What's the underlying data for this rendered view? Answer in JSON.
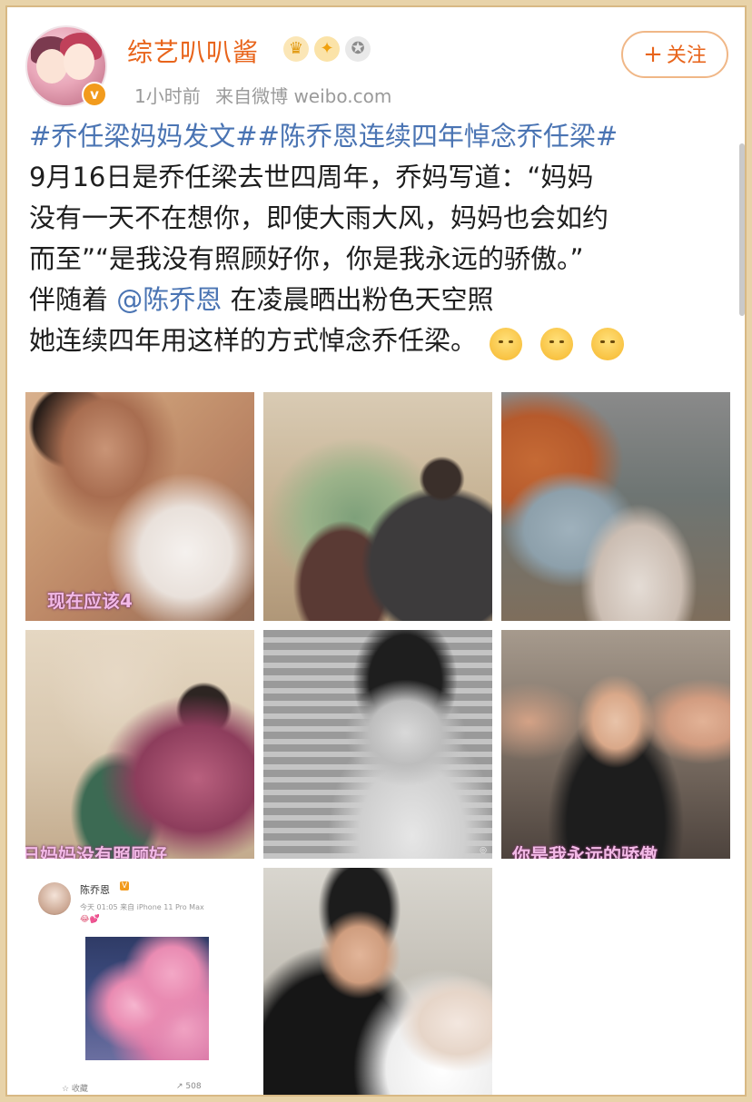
{
  "header": {
    "username": "综艺叭叭酱",
    "badges": [
      "crown-badge",
      "lightbulb-badge",
      "medal-badge"
    ],
    "time": "1小时前",
    "source": "来自微博 weibo.com",
    "follow_label": "关注"
  },
  "post": {
    "hashtags": "#乔任梁妈妈发文##陈乔恩连续四年悼念乔任梁#",
    "line2": "9月16日是乔任梁去世四周年，乔妈写道：“妈妈",
    "line3": "没有一天不在想你，即使大雨大风，妈妈也会如约",
    "line4": "而至”“是我没有照顾好你，你是我永远的骄傲。”",
    "line5_prefix": "伴随着 ",
    "mention": "@陈乔恩",
    "line5_suffix": " 在凌晨晒出粉色天空照",
    "line6": "她连续四年用这样的方式悼念乔任梁。",
    "emoji_count": 3
  },
  "photos": [
    {
      "caption": "现在应该4"
    },
    {
      "caption": ""
    },
    {
      "caption": ""
    },
    {
      "caption": "日妈妈没有照顾好"
    },
    {
      "caption": ""
    },
    {
      "caption": "你是我永远的骄傲"
    },
    {
      "mini_name": "陈乔恩",
      "mini_vip": "V",
      "mini_meta": "今天 01:05 来自 iPhone 11 Pro Max",
      "mini_emojis": "😂💕",
      "mini_fav": "☆ 收藏",
      "mini_share": "↗ 508"
    },
    {
      "caption": ""
    }
  ],
  "colors": {
    "accent": "#e8641b",
    "link": "#4a74b3",
    "frame": "#e8d3a9"
  }
}
